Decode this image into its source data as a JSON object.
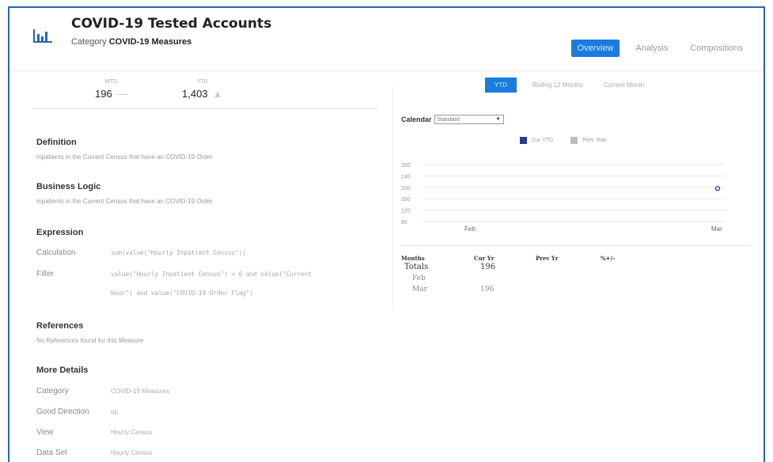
{
  "header": {
    "title": "COVID-19 Tested Accounts",
    "category_label": "Category",
    "category_value": "COVID-19 Measures",
    "tabs": [
      {
        "label": "Overview"
      },
      {
        "label": "Analysis"
      },
      {
        "label": "Compositions"
      }
    ]
  },
  "kpis": {
    "mtd_label": "MTD",
    "mtd_value": "196",
    "ytd_label": "YTD",
    "ytd_value": "1,403"
  },
  "definition": {
    "title": "Definition",
    "text": "Inpatients in the Current Census that have an COVID-19 Order"
  },
  "business_logic": {
    "title": "Business Logic",
    "text": "Inpatients in the Current Census that have an COVID-19 Order"
  },
  "expression": {
    "title": "Expression",
    "calc_label": "Calculation",
    "calc_value": "sum(value(\"Hourly Inpatient Census\"))",
    "filter_label": "Filter",
    "filter_line1": "value(\"Hourly Inpatient Census\") > 0 and value(\"Current",
    "filter_line2": "Hour\") and value(\"COVID-19 Order Flag\")"
  },
  "references": {
    "title": "References",
    "text": "No References found for this Measure"
  },
  "more_details": {
    "title": "More Details",
    "rows": [
      {
        "label": "Category",
        "value": "COVID-19 Measures"
      },
      {
        "label": "Good Direction",
        "value": "up"
      },
      {
        "label": "View",
        "value": "Hourly Census"
      },
      {
        "label": "Data Set",
        "value": "Hourly Census"
      }
    ]
  },
  "period_tabs": [
    {
      "label": "YTD"
    },
    {
      "label": "Rolling 12 Months"
    },
    {
      "label": "Current Month"
    }
  ],
  "calendar": {
    "label": "Calendar",
    "selected": "Standard"
  },
  "legend": {
    "cur": "Cur YTD",
    "prev": "Prev Year"
  },
  "colors": {
    "accent": "#1a7be0",
    "cur_series": "#1f3f8f",
    "prev_series": "#bdbdbd",
    "frame": "#2a63b8"
  },
  "chart_data": {
    "type": "line",
    "categories": [
      "Feb",
      "Mar"
    ],
    "series": [
      {
        "name": "Cur YTD",
        "values": [
          null,
          196
        ]
      },
      {
        "name": "Prev Year",
        "values": [
          null,
          null
        ]
      }
    ],
    "yticks": [
      "280",
      "240",
      "200",
      "160",
      "120",
      "80"
    ],
    "ylim": [
      80,
      280
    ],
    "grid": true
  },
  "table": {
    "headers": [
      "Months",
      "Cur Yr",
      "Prev Yr",
      "%+/-"
    ],
    "rows": [
      {
        "label": "Totals",
        "cur": "196"
      },
      {
        "label": "Feb",
        "cur": ""
      },
      {
        "label": "Mar",
        "cur": "196"
      }
    ]
  }
}
